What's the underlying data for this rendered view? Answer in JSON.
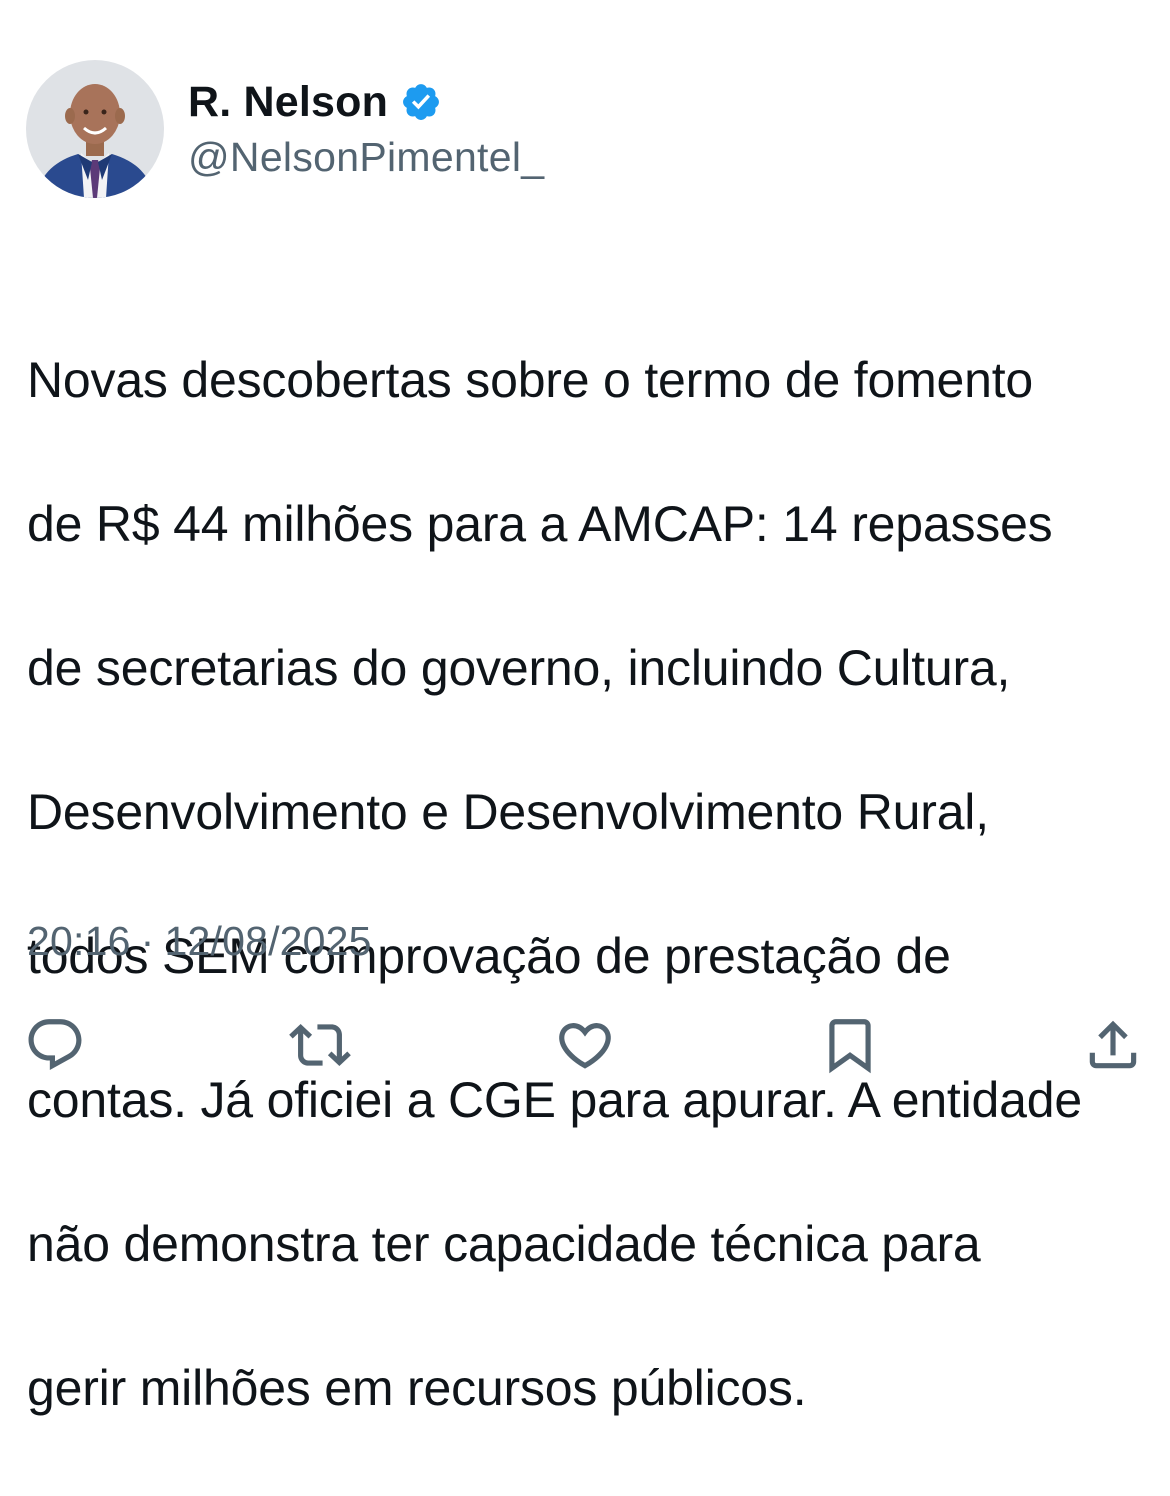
{
  "author": {
    "display_name": "R. Nelson",
    "handle": "@NelsonPimentel_",
    "verified": true,
    "verified_color": "#1d9bf0"
  },
  "tweet": {
    "lines": [
      "Novas descobertas sobre o termo de fomento",
      "de R$ 44 milhões para a AMCAP: 14 repasses",
      "de secretarias do governo, incluindo Cultura,",
      "Desenvolvimento e Desenvolvimento Rural,",
      "todos SEM comprovação de prestação de",
      "contas. Já oficiei a CGE para apurar. A entidade",
      "não demonstra ter capacidade técnica para",
      "gerir milhões em recursos públicos."
    ],
    "time": "20:16",
    "separator": "·",
    "date": "12/08/2025"
  },
  "actions": [
    {
      "name": "reply",
      "icon": "reply-icon"
    },
    {
      "name": "retweet",
      "icon": "retweet-icon"
    },
    {
      "name": "like",
      "icon": "heart-icon"
    },
    {
      "name": "bookmark",
      "icon": "bookmark-icon"
    },
    {
      "name": "share",
      "icon": "share-icon"
    }
  ],
  "colors": {
    "text_primary": "#0f1419",
    "text_secondary": "#536471"
  }
}
